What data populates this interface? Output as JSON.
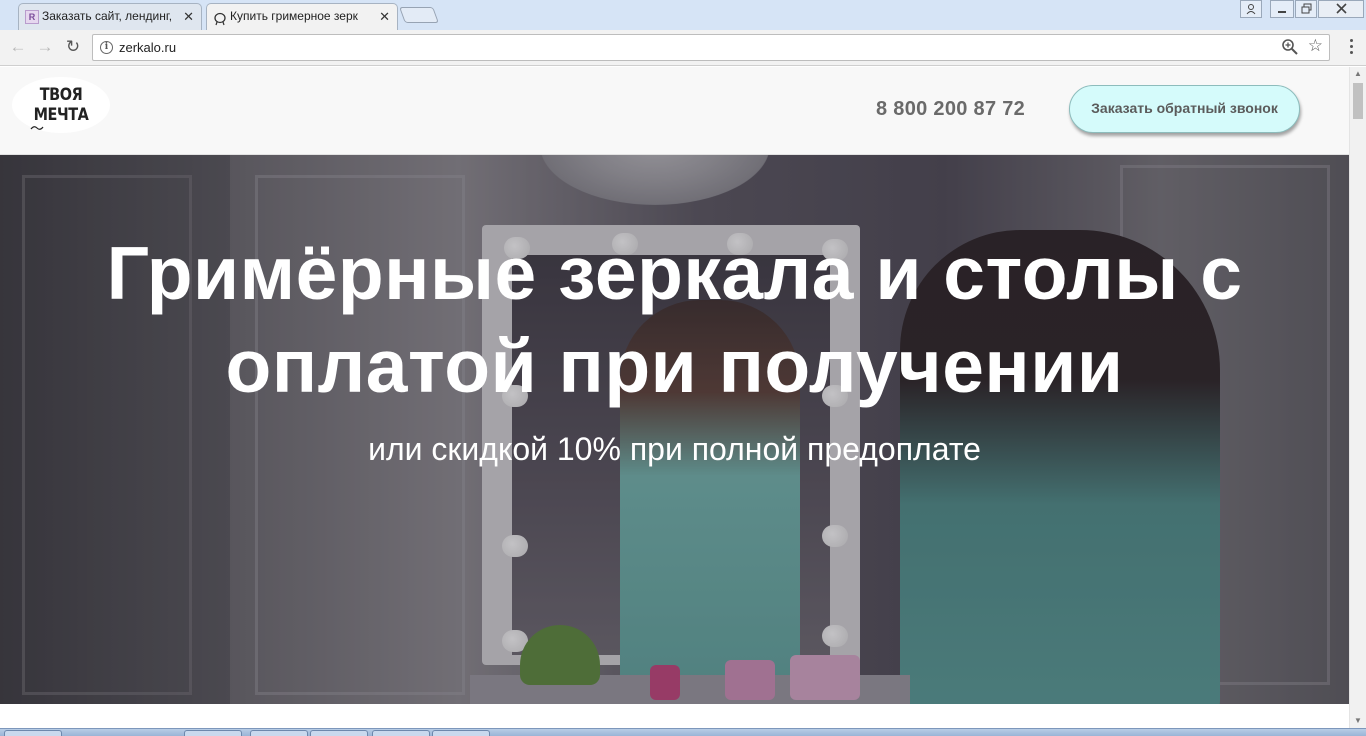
{
  "browser": {
    "tabs": [
      {
        "title": "Заказать сайт, лендинг,",
        "icon": "site-favicon-r",
        "icon_letter": "R",
        "active": false
      },
      {
        "title": "Купить гримерное зерк",
        "icon": "mirror-favicon",
        "active": true
      }
    ],
    "close_glyph": "✕",
    "address": {
      "url": "zerkalo.ru"
    },
    "nav": {
      "back": "←",
      "forward": "→",
      "reload": "↻"
    },
    "bookmark_star": "☆"
  },
  "site": {
    "logo": {
      "line1": "ТВОЯ",
      "line2": "МЕЧТА"
    },
    "phone": "8 800 200 87 72",
    "callback_label": "Заказать обратный звонок"
  },
  "hero": {
    "title": "Гримёрные зеркала и столы с оплатой при получении",
    "subtitle": "или скидкой 10% при полной предоплате"
  },
  "colors": {
    "callback_bg": "#d5fbfb",
    "phone_text": "#6a6a6a",
    "header_bg": "#f8f8f8"
  }
}
